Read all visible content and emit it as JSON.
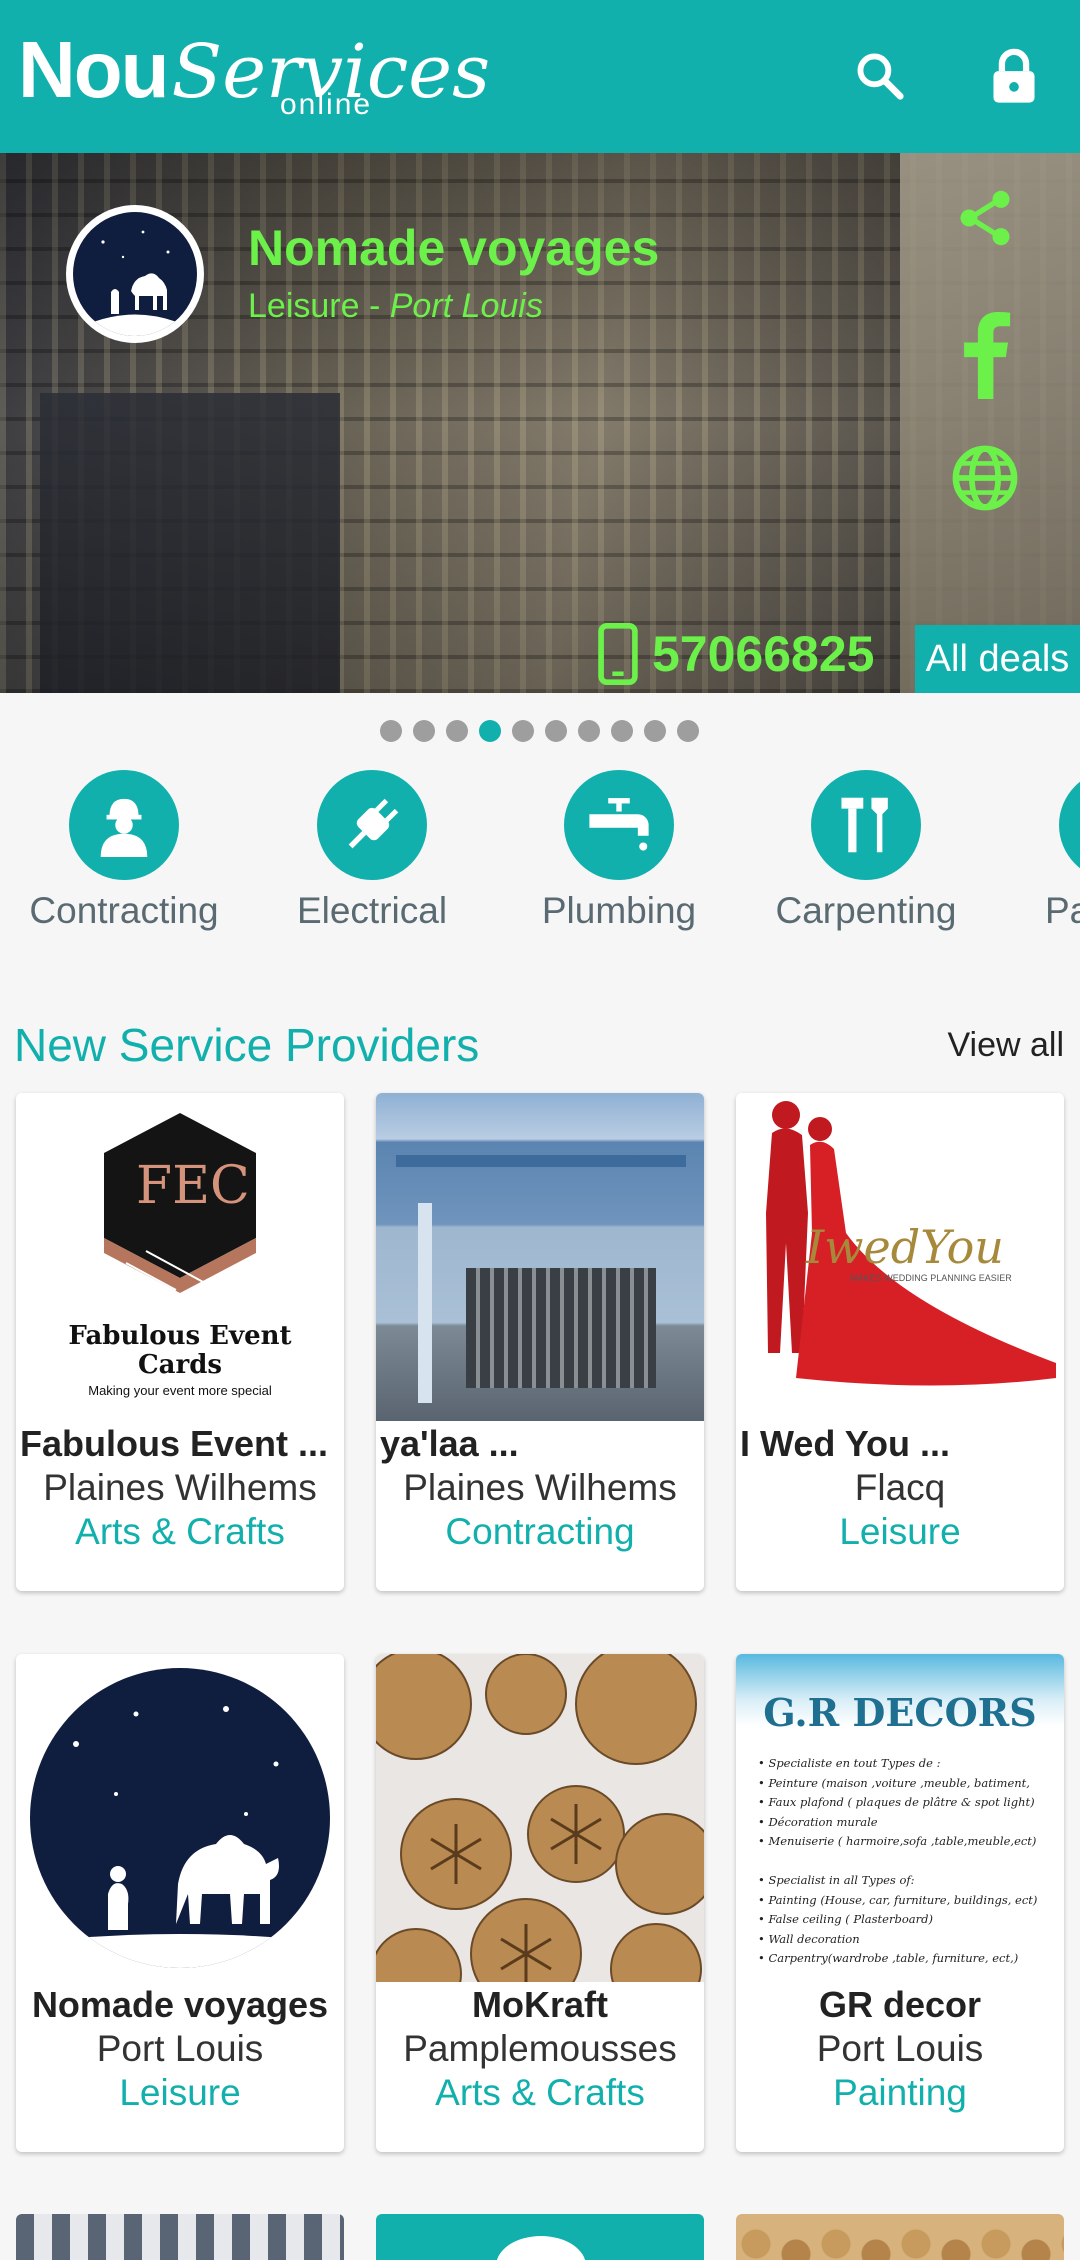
{
  "app": {
    "logo_word1": "Nou",
    "logo_word2": "Services",
    "logo_sub": "online",
    "search_icon": "search-icon",
    "lock_icon": "lock-icon",
    "brand_color": "#12b0ad"
  },
  "hero": {
    "title": "Nomade voyages",
    "category": "Leisure",
    "separator": " - ",
    "location": "Port Louis",
    "phone": "57066825",
    "all_deals": "All deals",
    "accent_color": "#6cf04a",
    "slides_total": 10,
    "active_slide": 4
  },
  "categories": [
    {
      "label": "Contracting",
      "icon": "worker-icon"
    },
    {
      "label": "Electrical",
      "icon": "plug-icon"
    },
    {
      "label": "Plumbing",
      "icon": "faucet-icon"
    },
    {
      "label": "Carpenting",
      "icon": "tools-icon"
    },
    {
      "label": "Pa",
      "icon": "paint-icon"
    }
  ],
  "section": {
    "title": "New Service Providers",
    "view_all": "View all"
  },
  "providers": [
    {
      "name": "Fabulous Event ...",
      "location": "Plaines Wilhems",
      "category": "Arts & Crafts",
      "logo_letters": "FEC",
      "logo_line1": "Fabulous Event",
      "logo_line2": "Cards",
      "logo_tagline": "Making your event more special"
    },
    {
      "name": "ya'laa ...",
      "location": "Plaines Wilhems",
      "category": "Contracting"
    },
    {
      "name": "I Wed You ...",
      "location": "Flacq",
      "category": "Leisure",
      "logo_text": "IwedYou",
      "logo_tagline": "MAKES WEDDING PLANNING EASIER"
    },
    {
      "name": "Nomade voyages",
      "location": "Port Louis",
      "category": "Leisure"
    },
    {
      "name": "MoKraft",
      "location": "Pamplemousses",
      "category": "Arts & Crafts"
    },
    {
      "name": "GR decor",
      "location": "Port Louis",
      "category": "Painting",
      "flyer_title": "G.R DECORS",
      "flyer_lines": [
        "Specialiste en tout Types de :",
        "Peinture (maison ,voiture ,meuble, batiment,",
        "Faux plafond ( plaques de plâtre & spot light)",
        "Décoration murale",
        "Menuiserie ( harmoire,sofa ,table,meuble,ect)",
        "",
        "Specialist in all Types of:",
        "Painting (House, car, furniture, buildings, ect)",
        "False ceiling ( Plasterboard)",
        "Wall decoration",
        "Carpentry(wardrobe ,table, furniture, ect,)"
      ]
    }
  ]
}
